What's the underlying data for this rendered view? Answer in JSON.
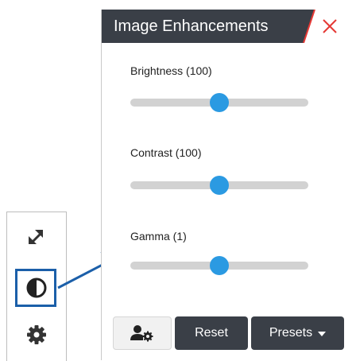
{
  "panel": {
    "title": "Image Enhancements",
    "sliders": [
      {
        "label": "Brightness (100)",
        "value": 100,
        "min": 0,
        "max": 200
      },
      {
        "label": "Contrast (100)",
        "value": 100,
        "min": 0,
        "max": 200
      },
      {
        "label": "Gamma (1)",
        "value": 1,
        "min": 0,
        "max": 2
      }
    ],
    "buttons": {
      "reset": "Reset",
      "presets": "Presets"
    }
  },
  "toolbar": {
    "items": [
      {
        "icon": "expand-icon",
        "selected": false
      },
      {
        "icon": "contrast-icon",
        "selected": true
      },
      {
        "icon": "gear-icon",
        "selected": false
      }
    ]
  },
  "colors": {
    "header": "#3a3f47",
    "accent": "#2b9ae2",
    "close": "#e53935",
    "highlight": "#1b5fa9"
  }
}
